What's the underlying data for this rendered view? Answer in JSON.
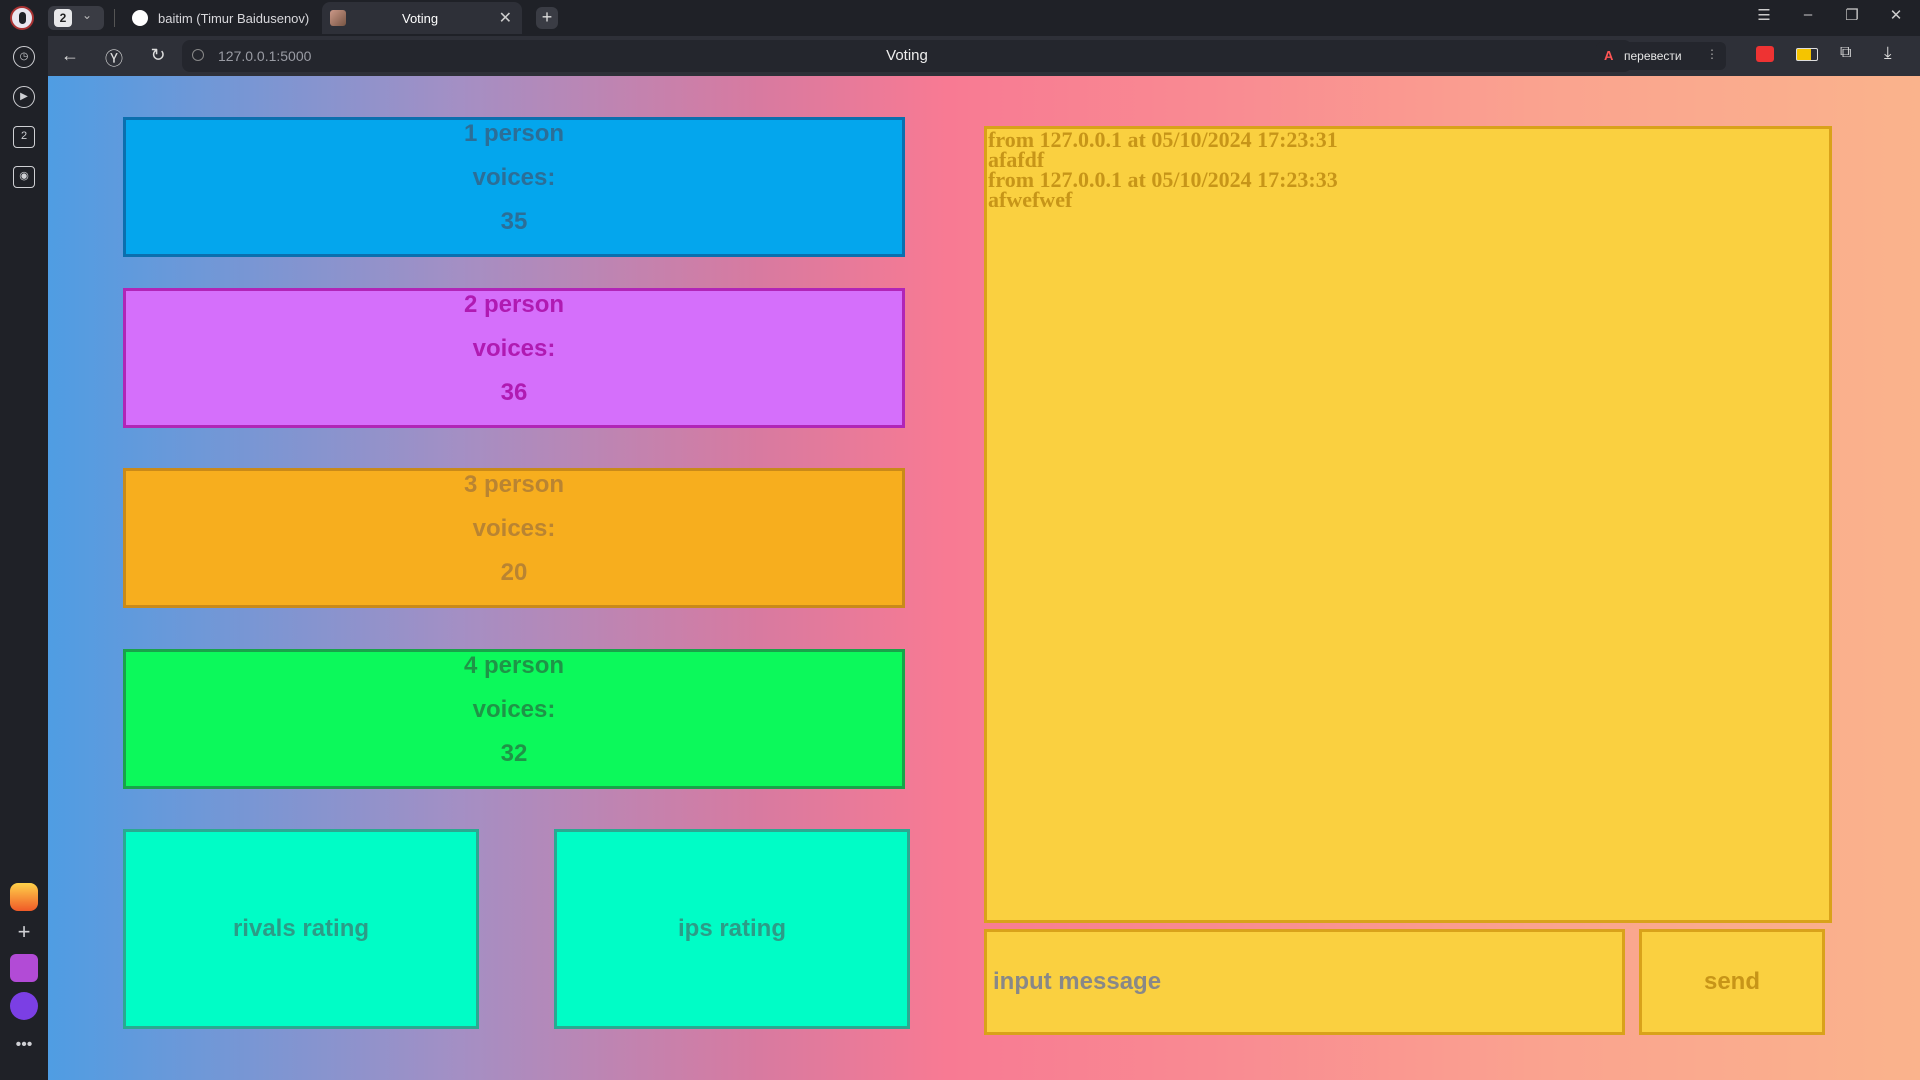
{
  "browser": {
    "tab_count": "2",
    "tabs": [
      {
        "label": "baitim (Timur Baidusenov)"
      },
      {
        "label": "Voting"
      }
    ],
    "url": "127.0.0.1:5000",
    "page_title": "Voting",
    "translate_label": "перевести"
  },
  "sidebar": {
    "items": [
      "history-icon",
      "video-icon",
      "tabs-icon",
      "screenshot-icon",
      "mail-app-icon",
      "add-icon",
      "alice-icon",
      "assistant-icon",
      "more-icon"
    ]
  },
  "candidates": [
    {
      "name": "1 person",
      "voices_label": "voices:",
      "votes": "35",
      "color": "#04a6ed"
    },
    {
      "name": "2 person",
      "voices_label": "voices:",
      "votes": "36",
      "color": "#d56ffb"
    },
    {
      "name": "3 person",
      "voices_label": "voices:",
      "votes": "20",
      "color": "#f7ae1e"
    },
    {
      "name": "4 person",
      "voices_label": "voices:",
      "votes": "32",
      "color": "#0cf95b"
    }
  ],
  "ratings": {
    "rivals_label": "rivals rating",
    "ips_label": "ips rating",
    "color": "#00fdc6"
  },
  "chat": {
    "messages": [
      {
        "meta": "from 127.0.0.1 at 05/10/2024 17:23:31",
        "text": "afafdf"
      },
      {
        "meta": "from 127.0.0.1 at 05/10/2024 17:23:33",
        "text": "afwefwef"
      }
    ],
    "input_placeholder": "input message",
    "send_label": "send",
    "color": "#fad040"
  }
}
